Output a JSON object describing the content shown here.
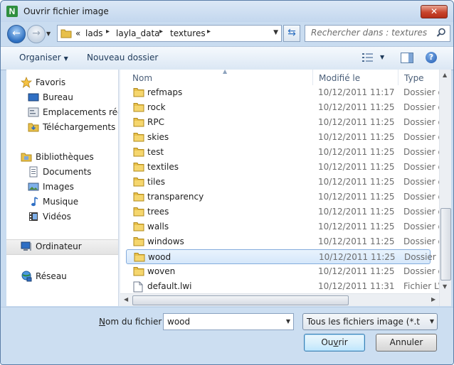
{
  "window": {
    "title": "Ouvrir fichier image",
    "app_icon_letter": "N"
  },
  "address": {
    "overflow": "«",
    "crumbs": [
      "lads",
      "layla_data",
      "textures"
    ],
    "search_placeholder": "Rechercher dans : textures"
  },
  "toolbar": {
    "organize_label": "Organiser",
    "new_folder_label": "Nouveau dossier"
  },
  "nav": {
    "favorites": {
      "label": "Favoris",
      "items": [
        "Bureau",
        "Emplacements récents",
        "Téléchargements"
      ]
    },
    "libraries": {
      "label": "Bibliothèques",
      "items": [
        "Documents",
        "Images",
        "Musique",
        "Vidéos"
      ]
    },
    "computer": {
      "label": "Ordinateur"
    },
    "network": {
      "label": "Réseau"
    }
  },
  "columns": {
    "name": "Nom",
    "modified": "Modifié le",
    "type": "Type"
  },
  "files": [
    {
      "name": "refmaps",
      "date": "10/12/2011 11:17",
      "type": "Dossier de fichiers",
      "kind": "folder"
    },
    {
      "name": "rock",
      "date": "10/12/2011 11:25",
      "type": "Dossier de fichiers",
      "kind": "folder"
    },
    {
      "name": "RPC",
      "date": "10/12/2011 11:25",
      "type": "Dossier de fichiers",
      "kind": "folder"
    },
    {
      "name": "skies",
      "date": "10/12/2011 11:25",
      "type": "Dossier de fichiers",
      "kind": "folder"
    },
    {
      "name": "test",
      "date": "10/12/2011 11:25",
      "type": "Dossier de fichiers",
      "kind": "folder"
    },
    {
      "name": "textiles",
      "date": "10/12/2011 11:25",
      "type": "Dossier de fichiers",
      "kind": "folder"
    },
    {
      "name": "tiles",
      "date": "10/12/2011 11:25",
      "type": "Dossier de fichiers",
      "kind": "folder"
    },
    {
      "name": "transparency",
      "date": "10/12/2011 11:25",
      "type": "Dossier de fichiers",
      "kind": "folder"
    },
    {
      "name": "trees",
      "date": "10/12/2011 11:25",
      "type": "Dossier de fichiers",
      "kind": "folder"
    },
    {
      "name": "walls",
      "date": "10/12/2011 11:25",
      "type": "Dossier de fichiers",
      "kind": "folder"
    },
    {
      "name": "windows",
      "date": "10/12/2011 11:25",
      "type": "Dossier de fichiers",
      "kind": "folder"
    },
    {
      "name": "wood",
      "date": "10/12/2011 11:25",
      "type": "Dossier de fichiers",
      "kind": "folder",
      "selected": true
    },
    {
      "name": "woven",
      "date": "10/12/2011 11:25",
      "type": "Dossier de fichiers",
      "kind": "folder"
    },
    {
      "name": "default.lwi",
      "date": "10/12/2011 11:31",
      "type": "Fichier LWI",
      "kind": "file"
    }
  ],
  "bottom": {
    "filename_label_first": "N",
    "filename_label_rest": "om du fichier :",
    "filename_value": "wood",
    "filter_value": "Tous les fichiers image (*.tif;*.tga;*.bmp)",
    "open_first": "Ou",
    "open_acc": "v",
    "open_rest": "rir",
    "cancel_label": "Annuler"
  },
  "colors": {
    "selection": "#d5e7fa",
    "selection_border": "#84acdd",
    "folder": "#e8c04a"
  }
}
